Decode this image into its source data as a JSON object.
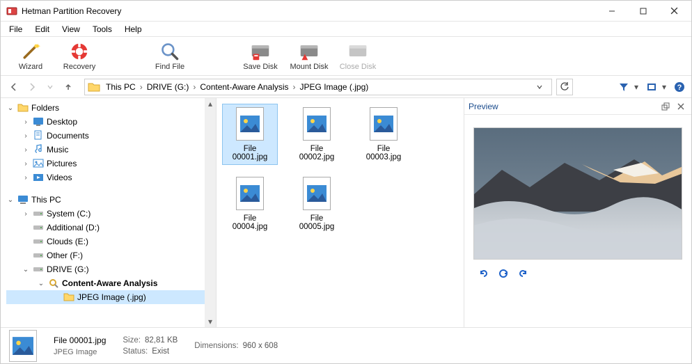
{
  "window": {
    "title": "Hetman Partition Recovery"
  },
  "menu": {
    "items": [
      "File",
      "Edit",
      "View",
      "Tools",
      "Help"
    ]
  },
  "toolbar": {
    "wizard": "Wizard",
    "recovery": "Recovery",
    "findfile": "Find File",
    "savedisk": "Save Disk",
    "mountdisk": "Mount Disk",
    "closedisk": "Close Disk"
  },
  "breadcrumb": {
    "parts": [
      "This PC",
      "DRIVE (G:)",
      "Content-Aware Analysis",
      "JPEG Image (.jpg)"
    ]
  },
  "tree": {
    "folders_root": "Folders",
    "user_folders": [
      "Desktop",
      "Documents",
      "Music",
      "Pictures",
      "Videos"
    ],
    "thispc": "This PC",
    "drives": [
      "System (C:)",
      "Additional (D:)",
      "Clouds (E:)",
      "Other (F:)"
    ],
    "drive_g": "DRIVE (G:)",
    "content_aware": "Content-Aware Analysis",
    "jpeg": "JPEG Image (.jpg)"
  },
  "files": [
    "File 00001.jpg",
    "File 00002.jpg",
    "File 00003.jpg",
    "File 00004.jpg",
    "File 00005.jpg"
  ],
  "preview": {
    "title": "Preview"
  },
  "status": {
    "filename": "File 00001.jpg",
    "filetype": "JPEG Image",
    "size_label": "Size:",
    "size_value": "82,81 KB",
    "status_label": "Status:",
    "status_value": "Exist",
    "dim_label": "Dimensions:",
    "dim_value": "960 x 608"
  }
}
